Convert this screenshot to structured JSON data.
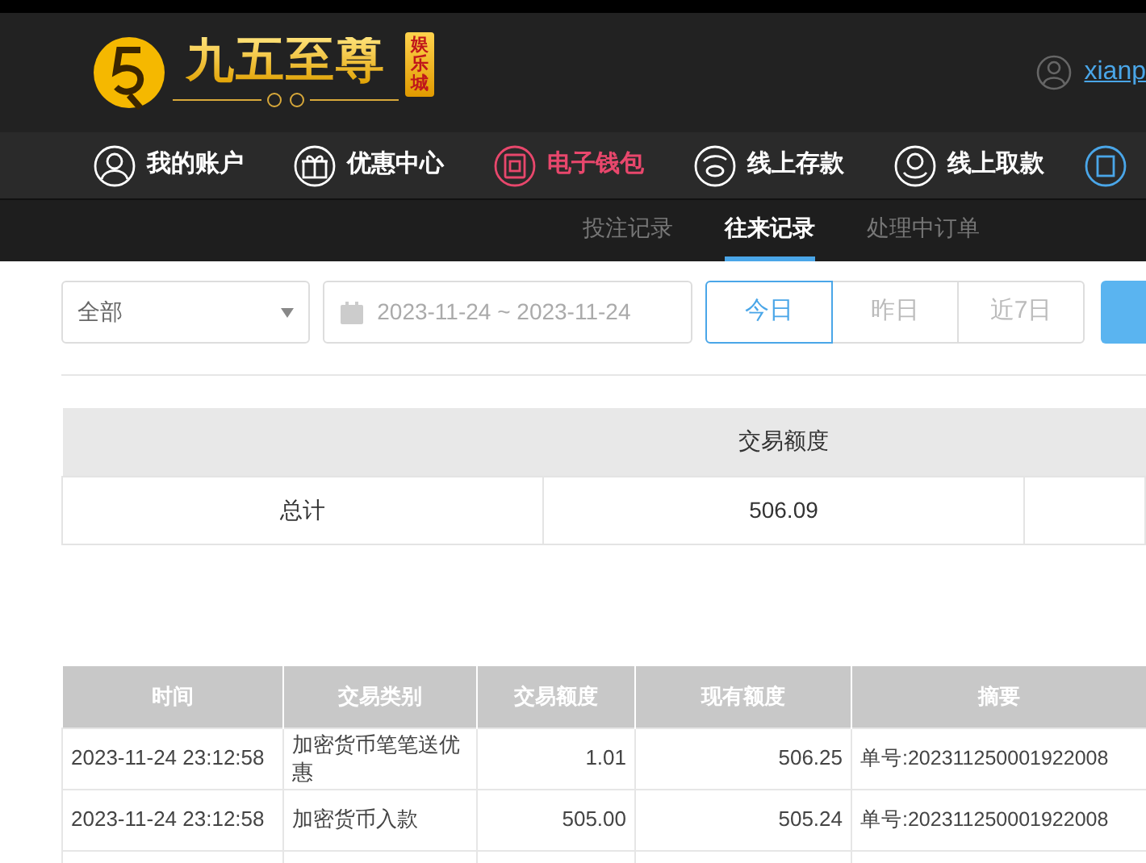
{
  "header": {
    "logo_text": "九五至尊",
    "logo_badge": "娱乐城",
    "username": "xianp"
  },
  "main_nav": [
    {
      "label": "我的账户",
      "selected": false
    },
    {
      "label": "优惠中心",
      "selected": false
    },
    {
      "label": "电子钱包",
      "selected": true
    },
    {
      "label": "线上存款",
      "selected": false
    },
    {
      "label": "线上取款",
      "selected": false
    }
  ],
  "sub_tabs": [
    {
      "label": "投注记录",
      "selected": false
    },
    {
      "label": "往来记录",
      "selected": true
    },
    {
      "label": "处理中订单",
      "selected": false
    }
  ],
  "filters": {
    "type_select": "全部",
    "date_range": "2023-11-24 ~ 2023-11-24",
    "quick_ranges": [
      {
        "label": "今日",
        "selected": true
      },
      {
        "label": "昨日",
        "selected": false
      },
      {
        "label": "近7日",
        "selected": false
      }
    ]
  },
  "summary_table": {
    "heading": "交易额度",
    "rows": [
      [
        "总计",
        "506.09"
      ]
    ]
  },
  "records_table": {
    "columns": [
      "时间",
      "交易类别",
      "交易额度",
      "现有额度",
      "摘要"
    ],
    "rows": [
      [
        "2023-11-24 23:12:58",
        "加密货币笔笔送优惠",
        "1.01",
        "506.25",
        "单号:202311250001922008"
      ],
      [
        "2023-11-24 23:12:58",
        "加密货币入款",
        "505.00",
        "505.24",
        "单号:202311250001922008"
      ]
    ]
  }
}
